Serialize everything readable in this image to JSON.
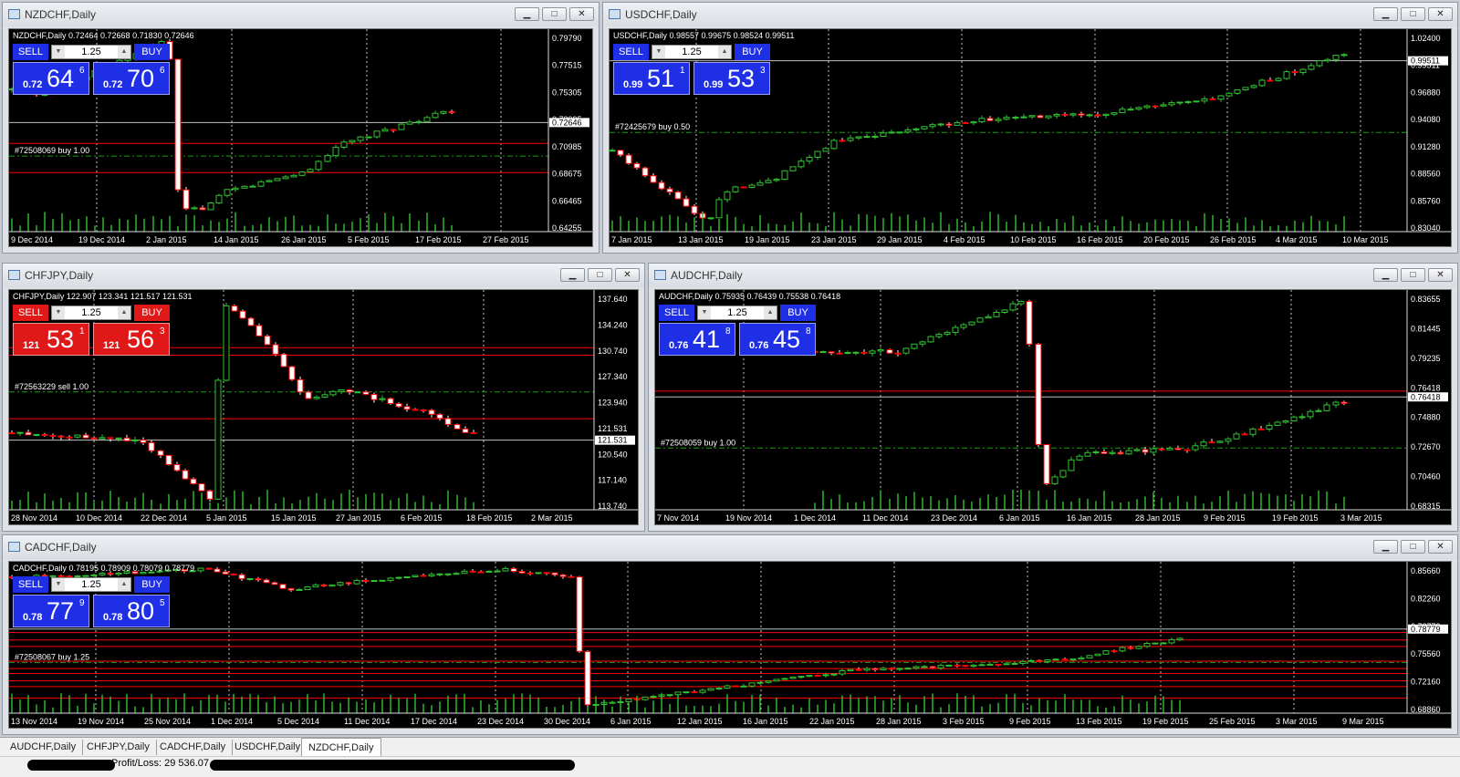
{
  "colors": {
    "bull": "#31c231",
    "bear": "#ffffff",
    "grid": "#c8c8c8",
    "order_line": "#ff0000",
    "trade_line": "#16a016",
    "price_line": "#c0c0c0",
    "panel_blue": "#1f2fe6",
    "panel_red": "#e01818",
    "axis_text": "#ffffff"
  },
  "status": {
    "profit_loss": "Profit/Loss: 29 536.07"
  },
  "tabs": [
    {
      "label": "AUDCHF,Daily",
      "active": false
    },
    {
      "label": "CHFJPY,Daily",
      "active": false
    },
    {
      "label": "CADCHF,Daily",
      "active": false
    },
    {
      "label": "USDCHF,Daily",
      "active": false
    },
    {
      "label": "NZDCHF,Daily",
      "active": true
    }
  ],
  "windows": [
    {
      "id": "nzdchf",
      "title": "NZDCHF,Daily",
      "symbol_line": "NZDCHF,Daily  0.72464 0.72668 0.71830 0.72646",
      "one_click": {
        "sell_label": "SELL",
        "buy_label": "BUY",
        "lot": "1.25",
        "color": "#1f2fe6",
        "sell_small": "0.72",
        "sell_big": "64",
        "sell_sup": "6",
        "buy_small": "0.72",
        "buy_big": "70",
        "buy_sup": "6"
      },
      "trade_label": "#72508069 buy 1.00",
      "price_label": "0.72646",
      "right_labels": [
        "0.79790",
        "0.77515",
        "0.75305",
        "0.73095",
        "0.70985",
        "0.68675",
        "0.66465",
        "0.64255"
      ],
      "date_labels": [
        "9 Dec 2014",
        "19 Dec 2014",
        "2 Jan 2015",
        "14 Jan 2015",
        "26 Jan 2015",
        "5 Feb 2015",
        "17 Feb 2015",
        "27 Feb 2015"
      ],
      "chart_data": {
        "type": "candlestick",
        "ylim": [
          0.6405,
          0.8
        ],
        "price": 0.72646,
        "trade_level": 0.7,
        "order_levels": [
          0.71,
          0.687
        ]
      }
    },
    {
      "id": "usdchf",
      "title": "USDCHF,Daily",
      "symbol_line": "USDCHF,Daily  0.98557 0.99675 0.98524 0.99511",
      "one_click": {
        "sell_label": "SELL",
        "buy_label": "BUY",
        "lot": "1.25",
        "color": "#1f2fe6",
        "sell_small": "0.99",
        "sell_big": "51",
        "sell_sup": "1",
        "buy_small": "0.99",
        "buy_big": "53",
        "buy_sup": "3"
      },
      "trade_label": "#72425679 buy 0.50",
      "price_label": "0.99511",
      "right_labels": [
        "1.02400",
        "0.99511",
        "0.96880",
        "0.94080",
        "0.91280",
        "0.88560",
        "0.85760",
        "0.83040"
      ],
      "date_labels": [
        "7 Jan 2015",
        "13 Jan 2015",
        "19 Jan 2015",
        "23 Jan 2015",
        "29 Jan 2015",
        "4 Feb 2015",
        "10 Feb 2015",
        "16 Feb 2015",
        "20 Feb 2015",
        "26 Feb 2015",
        "4 Mar 2015",
        "10 Mar 2015"
      ],
      "chart_data": {
        "type": "candlestick",
        "ylim": [
          0.828,
          1.026
        ],
        "price": 0.99511,
        "trade_level": 0.925,
        "order_levels": []
      }
    },
    {
      "id": "chfjpy",
      "title": "CHFJPY,Daily",
      "symbol_line": "CHFJPY,Daily  122.907 123.341 121.517 121.531",
      "one_click": {
        "sell_label": "SELL",
        "buy_label": "BUY",
        "lot": "1.25",
        "color": "#e01818",
        "sell_small": "121",
        "sell_big": "53",
        "sell_sup": "1",
        "buy_small": "121",
        "buy_big": "56",
        "buy_sup": "3"
      },
      "trade_label": "#72563229 sell 1.00",
      "price_label": "121.531",
      "right_labels": [
        "137.640",
        "134.240",
        "130.740",
        "127.340",
        "123.940",
        "121.531",
        "120.540",
        "117.140",
        "113.740"
      ],
      "date_labels": [
        "28 Nov 2014",
        "10 Dec 2014",
        "22 Dec 2014",
        "5 Jan 2015",
        "15 Jan 2015",
        "27 Jan 2015",
        "6 Feb 2015",
        "18 Feb 2015",
        "2 Mar 2015"
      ],
      "chart_data": {
        "type": "candlestick",
        "ylim": [
          113.2,
          139.5
        ],
        "price": 121.531,
        "trade_level": 127.3,
        "order_levels": [
          132.6,
          131.7,
          124.1
        ]
      }
    },
    {
      "id": "audchf",
      "title": "AUDCHF,Daily",
      "symbol_line": "AUDCHF,Daily  0.75935 0.76439 0.75538 0.76418",
      "one_click": {
        "sell_label": "SELL",
        "buy_label": "BUY",
        "lot": "1.25",
        "color": "#1f2fe6",
        "sell_small": "0.76",
        "sell_big": "41",
        "sell_sup": "8",
        "buy_small": "0.76",
        "buy_big": "45",
        "buy_sup": "8"
      },
      "trade_label": "#72508059 buy 1.00",
      "price_label": "0.76418",
      "right_labels": [
        "0.83655",
        "0.81445",
        "0.79235",
        "0.76418",
        "0.74880",
        "0.72670",
        "0.70460",
        "0.68315"
      ],
      "date_labels": [
        "7 Nov 2014",
        "19 Nov 2014",
        "1 Dec 2014",
        "11 Dec 2014",
        "23 Dec 2014",
        "6 Jan 2015",
        "16 Jan 2015",
        "28 Jan 2015",
        "9 Feb 2015",
        "19 Feb 2015",
        "3 Mar 2015"
      ],
      "chart_data": {
        "type": "candlestick",
        "ylim": [
          0.681,
          0.843
        ],
        "price": 0.76418,
        "trade_level": 0.7265,
        "order_levels": [
          0.7685
        ]
      }
    },
    {
      "id": "cadchf",
      "title": "CADCHF,Daily",
      "symbol_line": "CADCHF,Daily  0.78195 0.78909 0.78079 0.78779",
      "one_click": {
        "sell_label": "SELL",
        "buy_label": "BUY",
        "lot": "1.25",
        "color": "#1f2fe6",
        "sell_small": "0.78",
        "sell_big": "77",
        "sell_sup": "9",
        "buy_small": "0.78",
        "buy_big": "80",
        "buy_sup": "5"
      },
      "trade_label": "#72508067 buy 1.25",
      "price_label": "0.78779",
      "right_labels": [
        "0.85660",
        "0.82260",
        "0.78779",
        "0.75560",
        "0.72160",
        "0.68860"
      ],
      "date_labels": [
        "13 Nov 2014",
        "19 Nov 2014",
        "25 Nov 2014",
        "1 Dec 2014",
        "5 Dec 2014",
        "11 Dec 2014",
        "17 Dec 2014",
        "23 Dec 2014",
        "30 Dec 2014",
        "6 Jan 2015",
        "12 Jan 2015",
        "16 Jan 2015",
        "22 Jan 2015",
        "28 Jan 2015",
        "3 Feb 2015",
        "9 Feb 2015",
        "13 Feb 2015",
        "19 Feb 2015",
        "25 Feb 2015",
        "3 Mar 2015",
        "9 Mar 2015"
      ],
      "chart_data": {
        "type": "candlestick",
        "ylim": [
          0.685,
          0.87
        ],
        "price": 0.78779,
        "trade_level": 0.747,
        "order_levels": [
          0.7835,
          0.7745,
          0.7665,
          0.7485,
          0.7395,
          0.7335,
          0.7245,
          0.7175,
          0.7035
        ]
      }
    }
  ]
}
